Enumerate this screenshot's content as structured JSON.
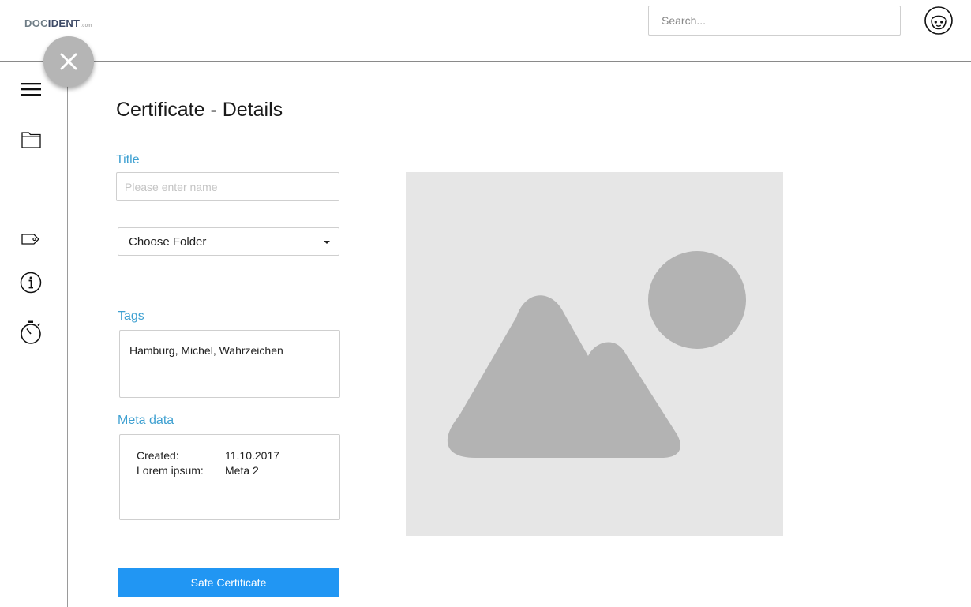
{
  "header": {
    "logo": {
      "part1": "DOC",
      "part2": "IDENT",
      "suffix": ".com"
    },
    "search": {
      "placeholder": "Search..."
    },
    "avatar_icon": "face-icon"
  },
  "sidebar": {
    "close_icon": "close-icon",
    "items": [
      {
        "name": "menu",
        "icon": "hamburger-icon"
      },
      {
        "name": "folder",
        "icon": "folder-icon"
      },
      {
        "name": "tag",
        "icon": "tag-icon"
      },
      {
        "name": "info",
        "icon": "info-icon"
      },
      {
        "name": "timer",
        "icon": "stopwatch-icon"
      }
    ]
  },
  "main": {
    "page_title": "Certificate - Details",
    "title_field": {
      "label": "Title",
      "placeholder": "Please enter name",
      "value": ""
    },
    "folder_select": {
      "value": "Choose Folder"
    },
    "tags": {
      "label": "Tags",
      "value": "Hamburg, Michel, Wahrzeichen"
    },
    "meta": {
      "label": "Meta data",
      "rows": [
        {
          "key": "Created:",
          "value": "11.10.2017"
        },
        {
          "key": "Lorem ipsum:",
          "value": "Meta 2"
        }
      ]
    },
    "save_button": "Safe Certificate",
    "image_icon": "image-placeholder-icon"
  },
  "colors": {
    "accent_label": "#3ea0d1",
    "primary_button": "#2196f3",
    "fab": "#b5b5b5",
    "placeholder_bg": "#e6e6e6",
    "placeholder_shape": "#b3b3b3"
  }
}
